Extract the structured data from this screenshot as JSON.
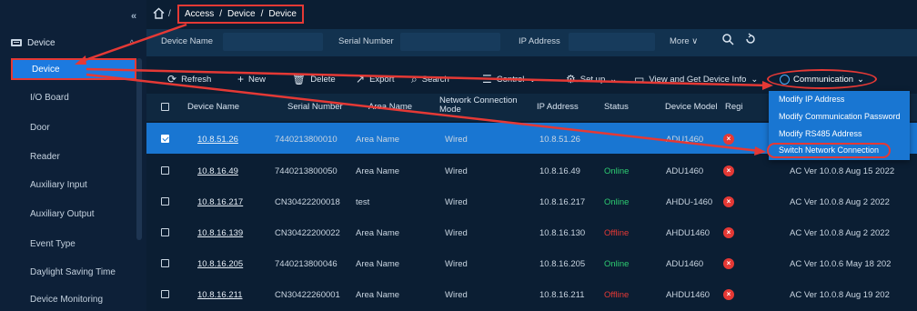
{
  "sidebar": {
    "collapse_glyph": "«",
    "group_label": "Device",
    "group_caret": "^",
    "items": [
      {
        "label": "Device"
      },
      {
        "label": "I/O Board"
      },
      {
        "label": "Door"
      },
      {
        "label": "Reader"
      },
      {
        "label": "Auxiliary Input"
      },
      {
        "label": "Auxiliary Output"
      },
      {
        "label": "Event Type"
      },
      {
        "label": "Daylight Saving Time"
      },
      {
        "label": "Device Monitoring"
      }
    ]
  },
  "breadcrumb": {
    "sep": "/",
    "items": [
      "Access",
      "/",
      "Device",
      "/",
      "Device"
    ]
  },
  "filters": {
    "device_name": "Device Name",
    "serial_number": "Serial Number",
    "ip_address": "IP Address",
    "more": "More ∨",
    "search_icon": "search-icon",
    "reset_icon": "reset-icon"
  },
  "toolbar": {
    "refresh": "Refresh",
    "new": "New",
    "delete": "Delete",
    "export": "Export",
    "search": "Search",
    "control": "Control",
    "setup": "Set up",
    "view": "View and Get Device Info",
    "communication": "Communication"
  },
  "table": {
    "columns": [
      "Device Name",
      "Serial Number",
      "Area Name",
      "Network Connection Mode",
      "IP Address",
      "Status",
      "Device Model",
      "Regi"
    ],
    "rows": [
      {
        "name": "10.8.51.26",
        "serial": "7440213800010",
        "area": "Area Name",
        "mode": "Wired",
        "ip": "10.8.51.26",
        "status": "",
        "model": "ADU1460",
        "fw": "",
        "selected": true
      },
      {
        "name": "10.8.16.49",
        "serial": "7440213800050",
        "area": "Area Name",
        "mode": "Wired",
        "ip": "10.8.16.49",
        "status": "Online",
        "model": "ADU1460",
        "fw": "AC Ver 10.0.8 Aug 15 2022",
        "selected": false
      },
      {
        "name": "10.8.16.217",
        "serial": "CN30422200018",
        "area": "test",
        "mode": "Wired",
        "ip": "10.8.16.217",
        "status": "Online",
        "model": "AHDU-1460",
        "fw": "AC Ver 10.0.8 Aug 2 2022",
        "selected": false
      },
      {
        "name": "10.8.16.139",
        "serial": "CN30422200022",
        "area": "Area Name",
        "mode": "Wired",
        "ip": "10.8.16.130",
        "status": "Offline",
        "model": "AHDU1460",
        "fw": "AC Ver 10.0.8 Aug 2 2022",
        "selected": false
      },
      {
        "name": "10.8.16.205",
        "serial": "7440213800046",
        "area": "Area Name",
        "mode": "Wired",
        "ip": "10.8.16.205",
        "status": "Online",
        "model": "ADU1460",
        "fw": "AC Ver 10.0.6 May 18 202",
        "selected": false
      },
      {
        "name": "10.8.16.211",
        "serial": "CN30422260001",
        "area": "Area Name",
        "mode": "Wired",
        "ip": "10.8.16.211",
        "status": "Offline",
        "model": "AHDU1460",
        "fw": "AC Ver 10.0.8 Aug 19 202",
        "selected": false
      }
    ]
  },
  "communication_menu": {
    "items": [
      "Modify IP Address",
      "Modify Communication Password",
      "Modify RS485 Address",
      "Switch Network Connection"
    ]
  },
  "colors": {
    "accent": "#1976d2",
    "annotation": "#e53935",
    "online": "#2ecc71",
    "background": "#0b1e33"
  }
}
